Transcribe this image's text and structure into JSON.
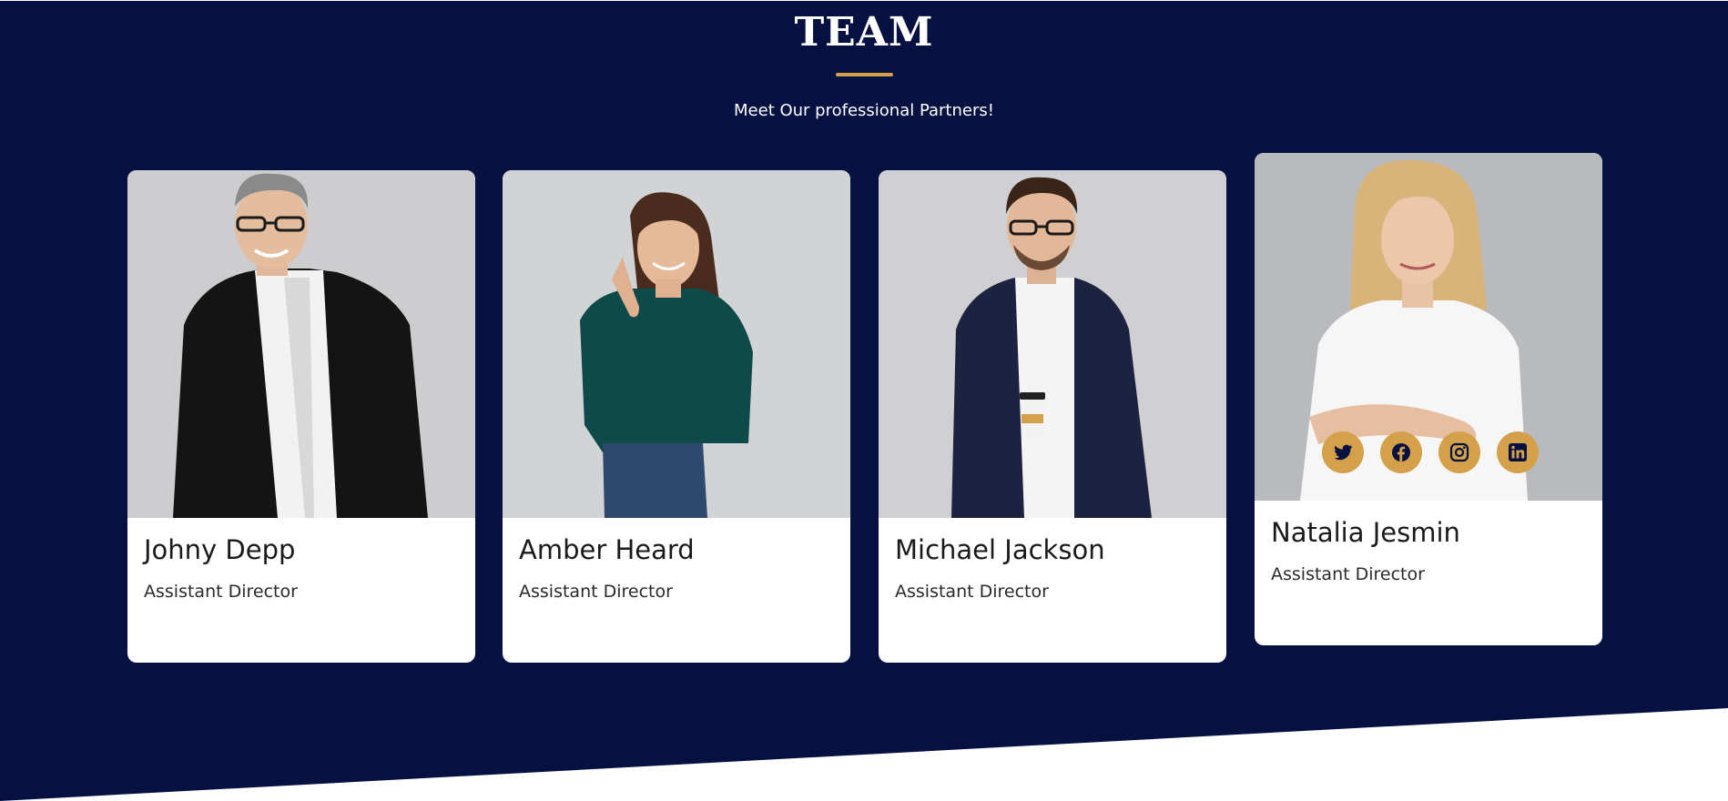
{
  "section": {
    "title": "TEAM",
    "subtitle": "Meet Our professional Partners!"
  },
  "colors": {
    "background": "#061142",
    "accent": "#d4a04a",
    "card": "#ffffff"
  },
  "members": [
    {
      "name": "Johny Depp",
      "role": "Assistant Director"
    },
    {
      "name": "Amber Heard",
      "role": "Assistant Director"
    },
    {
      "name": "Michael Jackson",
      "role": "Assistant Director"
    },
    {
      "name": "Natalia Jesmin",
      "role": "Assistant Director"
    }
  ],
  "socials": [
    {
      "icon": "twitter-icon"
    },
    {
      "icon": "facebook-icon"
    },
    {
      "icon": "instagram-icon"
    },
    {
      "icon": "linkedin-icon"
    }
  ]
}
